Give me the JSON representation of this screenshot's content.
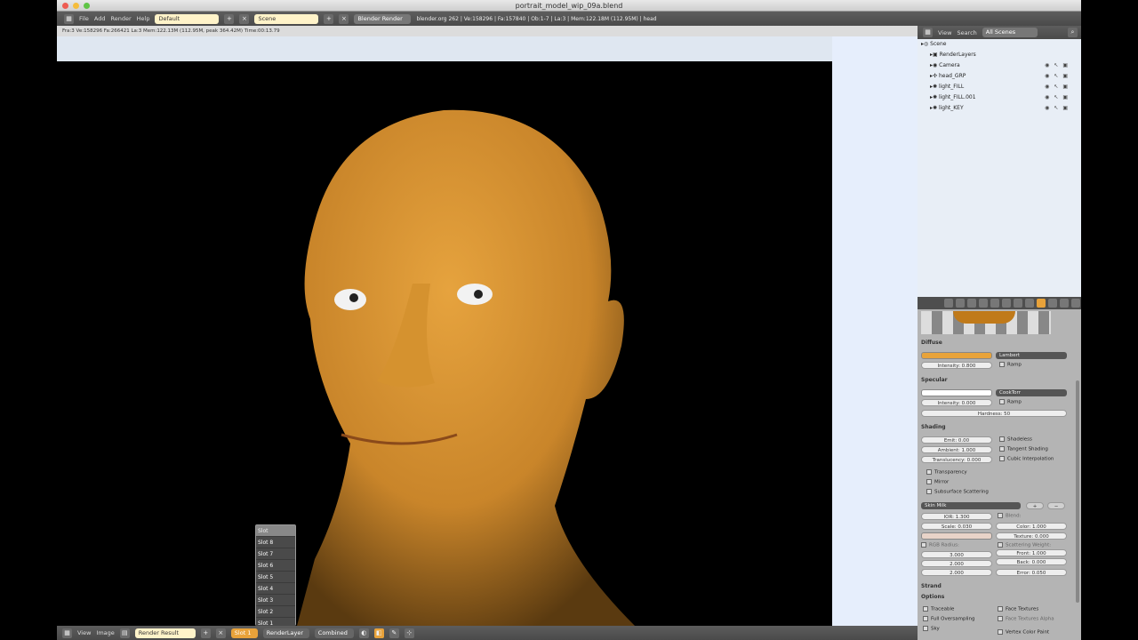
{
  "window": {
    "title": "portrait_model_wip_09a.blend"
  },
  "top_menu": {
    "items": [
      "File",
      "Add",
      "Render",
      "Help"
    ],
    "screen_field": "Default",
    "scene_field": "Scene",
    "engine": "Blender Render",
    "info": "blender.org 262 | Ve:158296 | Fa:157840 | Ob:1-7 | La:3 | Mem:122.18M (112.95M) | head"
  },
  "render_info": "Fra:3  Ve:158296 Fa:266421 La:3 Mem:122.13M (112.95M, peak 364.42M) Time:00:13.79",
  "image_editor": {
    "menus": [
      "View",
      "Image"
    ],
    "image_name": "Render Result",
    "slot_button": "Slot 1",
    "render_layer": "RenderLayer",
    "pass": "Combined"
  },
  "slot_menu": {
    "title": "Slot",
    "items": [
      "Slot 8",
      "Slot 7",
      "Slot 6",
      "Slot 5",
      "Slot 4",
      "Slot 3",
      "Slot 2",
      "Slot 1"
    ]
  },
  "outliner": {
    "menus": [
      "View",
      "Search"
    ],
    "filter": "All Scenes",
    "rows": [
      "Scene",
      "RenderLayers",
      "Camera",
      "head_GRP",
      "light_FILL",
      "light_FILL.001",
      "light_KEY"
    ]
  },
  "properties": {
    "diffuse": {
      "title": "Diffuse",
      "shader": "Lambert",
      "intensity": "Intensity: 0.800",
      "ramp": "Ramp",
      "color": "#e8a33a"
    },
    "specular": {
      "title": "Specular",
      "shader": "CookTorr",
      "intensity": "Intensity: 0.000",
      "ramp": "Ramp",
      "hardness": "Hardness: 50",
      "color": "#ffffff"
    },
    "shading": {
      "title": "Shading",
      "emit": "Emit: 0.00",
      "ambient": "Ambient: 1.000",
      "translucency": "Translucency: 0.000",
      "shadeless": "Shadeless",
      "tangent": "Tangent Shading",
      "cubic": "Cubic Interpolation"
    },
    "transparency": "Transparency",
    "mirror": "Mirror",
    "sss": {
      "title": "Subsurface Scattering",
      "preset": "Skin Milk",
      "ior": "IOR: 1.300",
      "scale": "Scale: 0.030",
      "blend_label": "Blend:",
      "color": "Color: 1.000",
      "texture": "Texture: 0.000",
      "rgb_radius": "RGB Radius:",
      "r1": "3.000",
      "r2": "2.000",
      "r3": "2.000",
      "scatter_weight": "Scattering Weight:",
      "front": "Front: 1.000",
      "back": "Back: 0.000",
      "error": "Error: 0.050"
    },
    "strand": "Strand",
    "options": {
      "title": "Options",
      "traceable": "Traceable",
      "full_oversampling": "Full Oversampling",
      "sky": "Sky",
      "face_textures": "Face Textures",
      "face_textures_alpha": "Face Textures Alpha",
      "vertex_color_paint": "Vertex Color Paint"
    }
  }
}
